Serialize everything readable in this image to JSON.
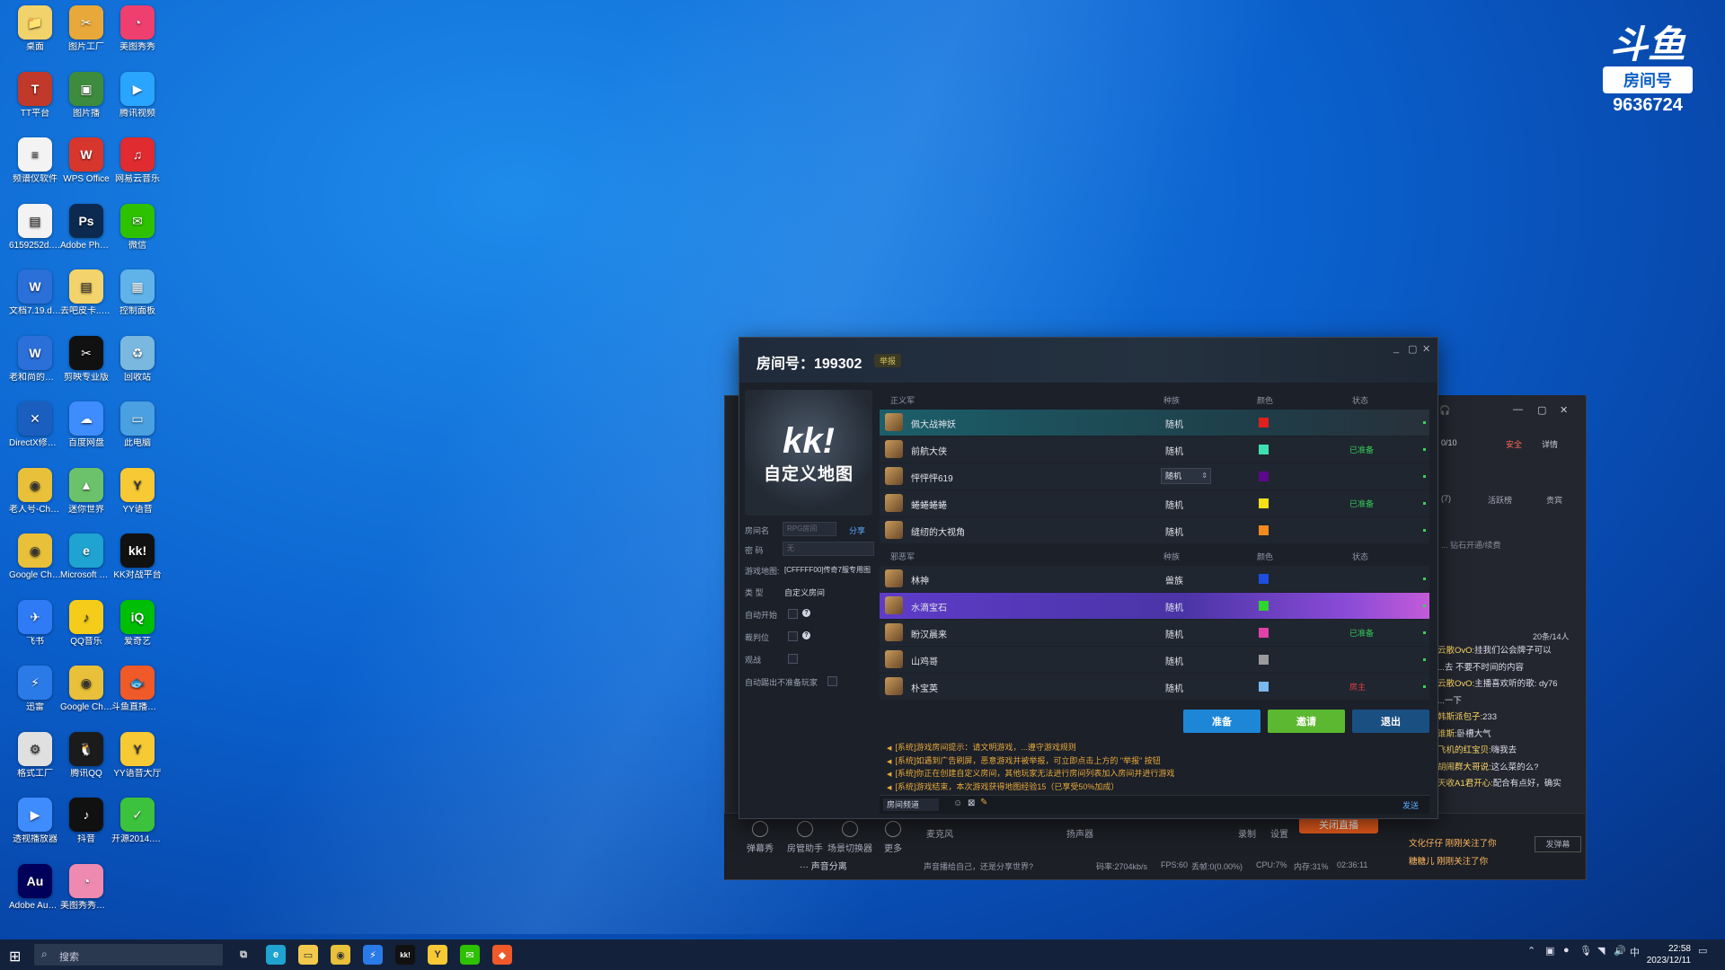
{
  "desktop": {
    "icons": [
      {
        "label": "桌面",
        "color": "#f2d36b",
        "glyph": "📁",
        "col": 0,
        "row": 0
      },
      {
        "label": "图片工厂",
        "color": "#e8a93a",
        "glyph": "✂",
        "col": 1,
        "row": 0
      },
      {
        "label": "美图秀秀",
        "color": "#ee3f6f",
        "glyph": "◔",
        "col": 2,
        "row": 0
      },
      {
        "label": "TT平台",
        "color": "#c0392b",
        "glyph": "T",
        "col": 0,
        "row": 1
      },
      {
        "label": "图片播",
        "color": "#3d8c3d",
        "glyph": "▣",
        "col": 1,
        "row": 1
      },
      {
        "label": "腾讯视频",
        "color": "#2aa5ff",
        "glyph": "▶",
        "col": 2,
        "row": 1
      },
      {
        "label": "频谱仪软件",
        "color": "#f3f3f3",
        "glyph": "≡",
        "col": 0,
        "row": 2
      },
      {
        "label": "WPS Office",
        "color": "#d7362d",
        "glyph": "W",
        "col": 1,
        "row": 2
      },
      {
        "label": "网易云音乐",
        "color": "#e02b30",
        "glyph": "♫",
        "col": 2,
        "row": 2
      },
      {
        "label": "6159252d...副本.jpg",
        "color": "#f3f3f3",
        "glyph": "▤",
        "col": 0,
        "row": 3
      },
      {
        "label": "Adobe Photosh...",
        "color": "#0c2a4f",
        "glyph": "Ps",
        "col": 1,
        "row": 3
      },
      {
        "label": "微信",
        "color": "#2dc100",
        "glyph": "✉",
        "col": 2,
        "row": 3
      },
      {
        "label": "文档7.19.doc",
        "color": "#2b6fd8",
        "glyph": "W",
        "col": 0,
        "row": 4
      },
      {
        "label": "去吧皮卡...伊布.jpg",
        "color": "#f3d36b",
        "glyph": "▤",
        "col": 1,
        "row": 4
      },
      {
        "label": "控制面板",
        "color": "#60b3e8",
        "glyph": "▦",
        "col": 2,
        "row": 4
      },
      {
        "label": "老和尚的区别.docx",
        "color": "#2b6fd8",
        "glyph": "W",
        "col": 0,
        "row": 5
      },
      {
        "label": "剪映专业版",
        "color": "#111111",
        "glyph": "✂",
        "col": 1,
        "row": 5
      },
      {
        "label": "回收站",
        "color": "#7ab8e0",
        "glyph": "♻",
        "col": 2,
        "row": 5
      },
      {
        "label": "DirectX修复工具",
        "color": "#1a5fbf",
        "glyph": "✕",
        "col": 0,
        "row": 6
      },
      {
        "label": "百度网盘",
        "color": "#3f8cff",
        "glyph": "☁",
        "col": 1,
        "row": 6
      },
      {
        "label": "此电脑",
        "color": "#4aa0e0",
        "glyph": "▭",
        "col": 2,
        "row": 6
      },
      {
        "label": "老人号-Chrome",
        "color": "#e8c03a",
        "glyph": "◉",
        "col": 0,
        "row": 7
      },
      {
        "label": "迷你世界",
        "color": "#6bc26b",
        "glyph": "▲",
        "col": 1,
        "row": 7
      },
      {
        "label": "YY语音",
        "color": "#f7c935",
        "glyph": "Y",
        "col": 2,
        "row": 7
      },
      {
        "label": "Google Chrome",
        "color": "#e8c03a",
        "glyph": "◉",
        "col": 0,
        "row": 8
      },
      {
        "label": "Microsoft Edge",
        "color": "#1fa3d1",
        "glyph": "e",
        "col": 1,
        "row": 8
      },
      {
        "label": "KK对战平台",
        "color": "#111111",
        "glyph": "kk!",
        "col": 2,
        "row": 8
      },
      {
        "label": "飞书",
        "color": "#2f7bf5",
        "glyph": "✈",
        "col": 0,
        "row": 9
      },
      {
        "label": "QQ音乐",
        "color": "#f5cc1a",
        "glyph": "♪",
        "col": 1,
        "row": 9
      },
      {
        "label": "爱奇艺",
        "color": "#00be06",
        "glyph": "iQ",
        "col": 2,
        "row": 9
      },
      {
        "label": "迅雷",
        "color": "#2a7be8",
        "glyph": "⚡",
        "col": 0,
        "row": 10
      },
      {
        "label": "Google Chrome",
        "color": "#e8c03a",
        "glyph": "◉",
        "col": 1,
        "row": 10
      },
      {
        "label": "斗鱼直播伴侣",
        "color": "#f05a28",
        "glyph": "🐟",
        "col": 2,
        "row": 10
      },
      {
        "label": "格式工厂",
        "color": "#e0e0e0",
        "glyph": "⚙",
        "col": 0,
        "row": 11
      },
      {
        "label": "腾讯QQ",
        "color": "#1b1b1b",
        "glyph": "🐧",
        "col": 1,
        "row": 11
      },
      {
        "label": "YY语音大厅",
        "color": "#f7c935",
        "glyph": "Y",
        "col": 2,
        "row": 11
      },
      {
        "label": "透视播放器",
        "color": "#3f8cff",
        "glyph": "▶",
        "col": 0,
        "row": 12
      },
      {
        "label": "抖音",
        "color": "#111111",
        "glyph": "♪",
        "col": 1,
        "row": 12
      },
      {
        "label": "开源2014.11专版",
        "color": "#3cc23c",
        "glyph": "✓",
        "col": 2,
        "row": 12
      },
      {
        "label": "Adobe Auditi...",
        "color": "#00005b",
        "glyph": "Au",
        "col": 0,
        "row": 13
      },
      {
        "label": "美图秀秀批处理",
        "color": "#ee8ab0",
        "glyph": "◔",
        "col": 1,
        "row": 13
      }
    ]
  },
  "douyu": {
    "brand": "斗鱼",
    "room_label": "房间号",
    "room_number": "9636724"
  },
  "lobby": {
    "title": "房间号：199302",
    "tag": "举报",
    "banner": {
      "logo": "kk!",
      "subtitle": "自定义地图"
    },
    "info": {
      "room_name_label": "房间名",
      "room_name_value": "RPG房间",
      "share": "分享",
      "password_label": "密 码",
      "password_value": "无",
      "map_label": "游戏地图:",
      "map_value": "[CFFFFF00]传奇7服专用图",
      "type_label": "类 型",
      "type_value": "自定义房间",
      "auto_start": "自动开始",
      "referee": "裁判位",
      "observer": "观战",
      "auto_kick": "自动踢出不准备玩家"
    },
    "team1": {
      "header": "正义军",
      "race_h": "种族",
      "color_h": "颜色",
      "status_h": "状态",
      "players": [
        {
          "name": "佩大战神妖",
          "race": "随机",
          "color": "#e0201e",
          "status": "",
          "status_color": "#34c85a",
          "hl": "hl"
        },
        {
          "name": "前航大侠",
          "race": "随机",
          "color": "#3fe0b0",
          "status": "已准备",
          "status_color": "#34c85a",
          "hl": ""
        },
        {
          "name": "怦怦怦619",
          "race": "随机",
          "color": "#5a0a8a",
          "status": "",
          "status_color": "#34c85a",
          "hl": "",
          "select": true
        },
        {
          "name": "蜷蜷蜷蜷",
          "race": "随机",
          "color": "#f5e016",
          "status": "已准备",
          "status_color": "#34c85a",
          "hl": ""
        },
        {
          "name": "缝纫的大视角",
          "race": "随机",
          "color": "#f58a1e",
          "status": "",
          "status_color": "#34c85a",
          "hl": ""
        }
      ]
    },
    "team2": {
      "header": "邪恶军",
      "race_h": "种族",
      "color_h": "颜色",
      "status_h": "状态",
      "players": [
        {
          "name": "林神",
          "race": "兽族",
          "color": "#1e4ee0",
          "status": "",
          "status_color": "#34c85a",
          "hl": ""
        },
        {
          "name": "水滴宝石",
          "race": "随机",
          "color": "#2fd42f",
          "status": "",
          "status_color": "#34c85a",
          "hl": "hl2"
        },
        {
          "name": "盼汉晨来",
          "race": "随机",
          "color": "#e040a8",
          "status": "已准备",
          "status_color": "#34c85a",
          "hl": ""
        },
        {
          "name": "山鸡哥",
          "race": "随机",
          "color": "#9a9a9a",
          "status": "",
          "status_color": "#34c85a",
          "hl": ""
        },
        {
          "name": "朴宝英",
          "race": "随机",
          "color": "#7ab8f0",
          "status": "房主",
          "status_color": "#e04040",
          "hl": ""
        }
      ]
    },
    "buttons": {
      "ready": "准备",
      "invite": "邀请",
      "exit": "退出"
    },
    "messages": [
      "[系统]游戏房间提示：请文明游戏，...遵守游戏规则",
      "[系统]如遇到广告刷屏，恶意游戏并被举报，可立即点击上方的 \"举报\" 按钮",
      "[系统]你正在创建自定义房间，其他玩家无法进行房间列表加入房间并进行游戏",
      "[系统]游戏结束，本次游戏获得地图经验15（已享受50%加成）"
    ],
    "chat": {
      "channel": "房间频道",
      "send": "发送"
    }
  },
  "stream_app": {
    "bottom_tools": [
      "弹幕秀",
      "房管助手",
      "场景切换器",
      "更多"
    ],
    "mic": "麦克风",
    "speaker": "扬声器",
    "record": "录制",
    "settings": "设置",
    "live_button": "关闭直播",
    "sound_split": "··· 声音分离",
    "status": "声音播给自己，还是分享世界?",
    "bitrate": "码率:2704kb/s",
    "fps": "FPS:60",
    "drop": "丢帧:0(0.00%)",
    "cpu": "CPU:7%",
    "mem": "内存:31%",
    "time": "02:36:11",
    "viewer_count": "0/10",
    "safe": "安全",
    "detail": "详情",
    "tabs": [
      "(7)",
      "活跃榜",
      "贵宾"
    ],
    "notice": "... 钻石开通/续费",
    "online": "20条/14人",
    "chat": [
      {
        "name": "云散OvO:",
        "text": "挂我们公会牌子可以"
      },
      {
        "name": "",
        "text": "...去 不要不时间的内容"
      },
      {
        "name": "云散OvO:",
        "text": "主播喜欢听的歌: dy76"
      },
      {
        "name": "",
        "text": "...一下"
      },
      {
        "name": "韩斯派包子:",
        "text": "233"
      },
      {
        "name": "谁斯:",
        "text": "卧槽大气"
      },
      {
        "name": "飞机的红宝贝:",
        "text": "嗨我去"
      },
      {
        "name": "胡闹群大哥说:",
        "text": "这么菜的么?"
      },
      {
        "name": "天收A1君开心:",
        "text": "配合有点好，确实"
      }
    ],
    "follows": [
      "文化仔仔 刚刚关注了你",
      "糖糖儿 刚刚关注了你"
    ],
    "follow_button": "发弹幕"
  },
  "taskbar": {
    "search_placeholder": "搜索",
    "clock_time": "22:58",
    "clock_date": "2023/12/11",
    "ime": "中"
  }
}
